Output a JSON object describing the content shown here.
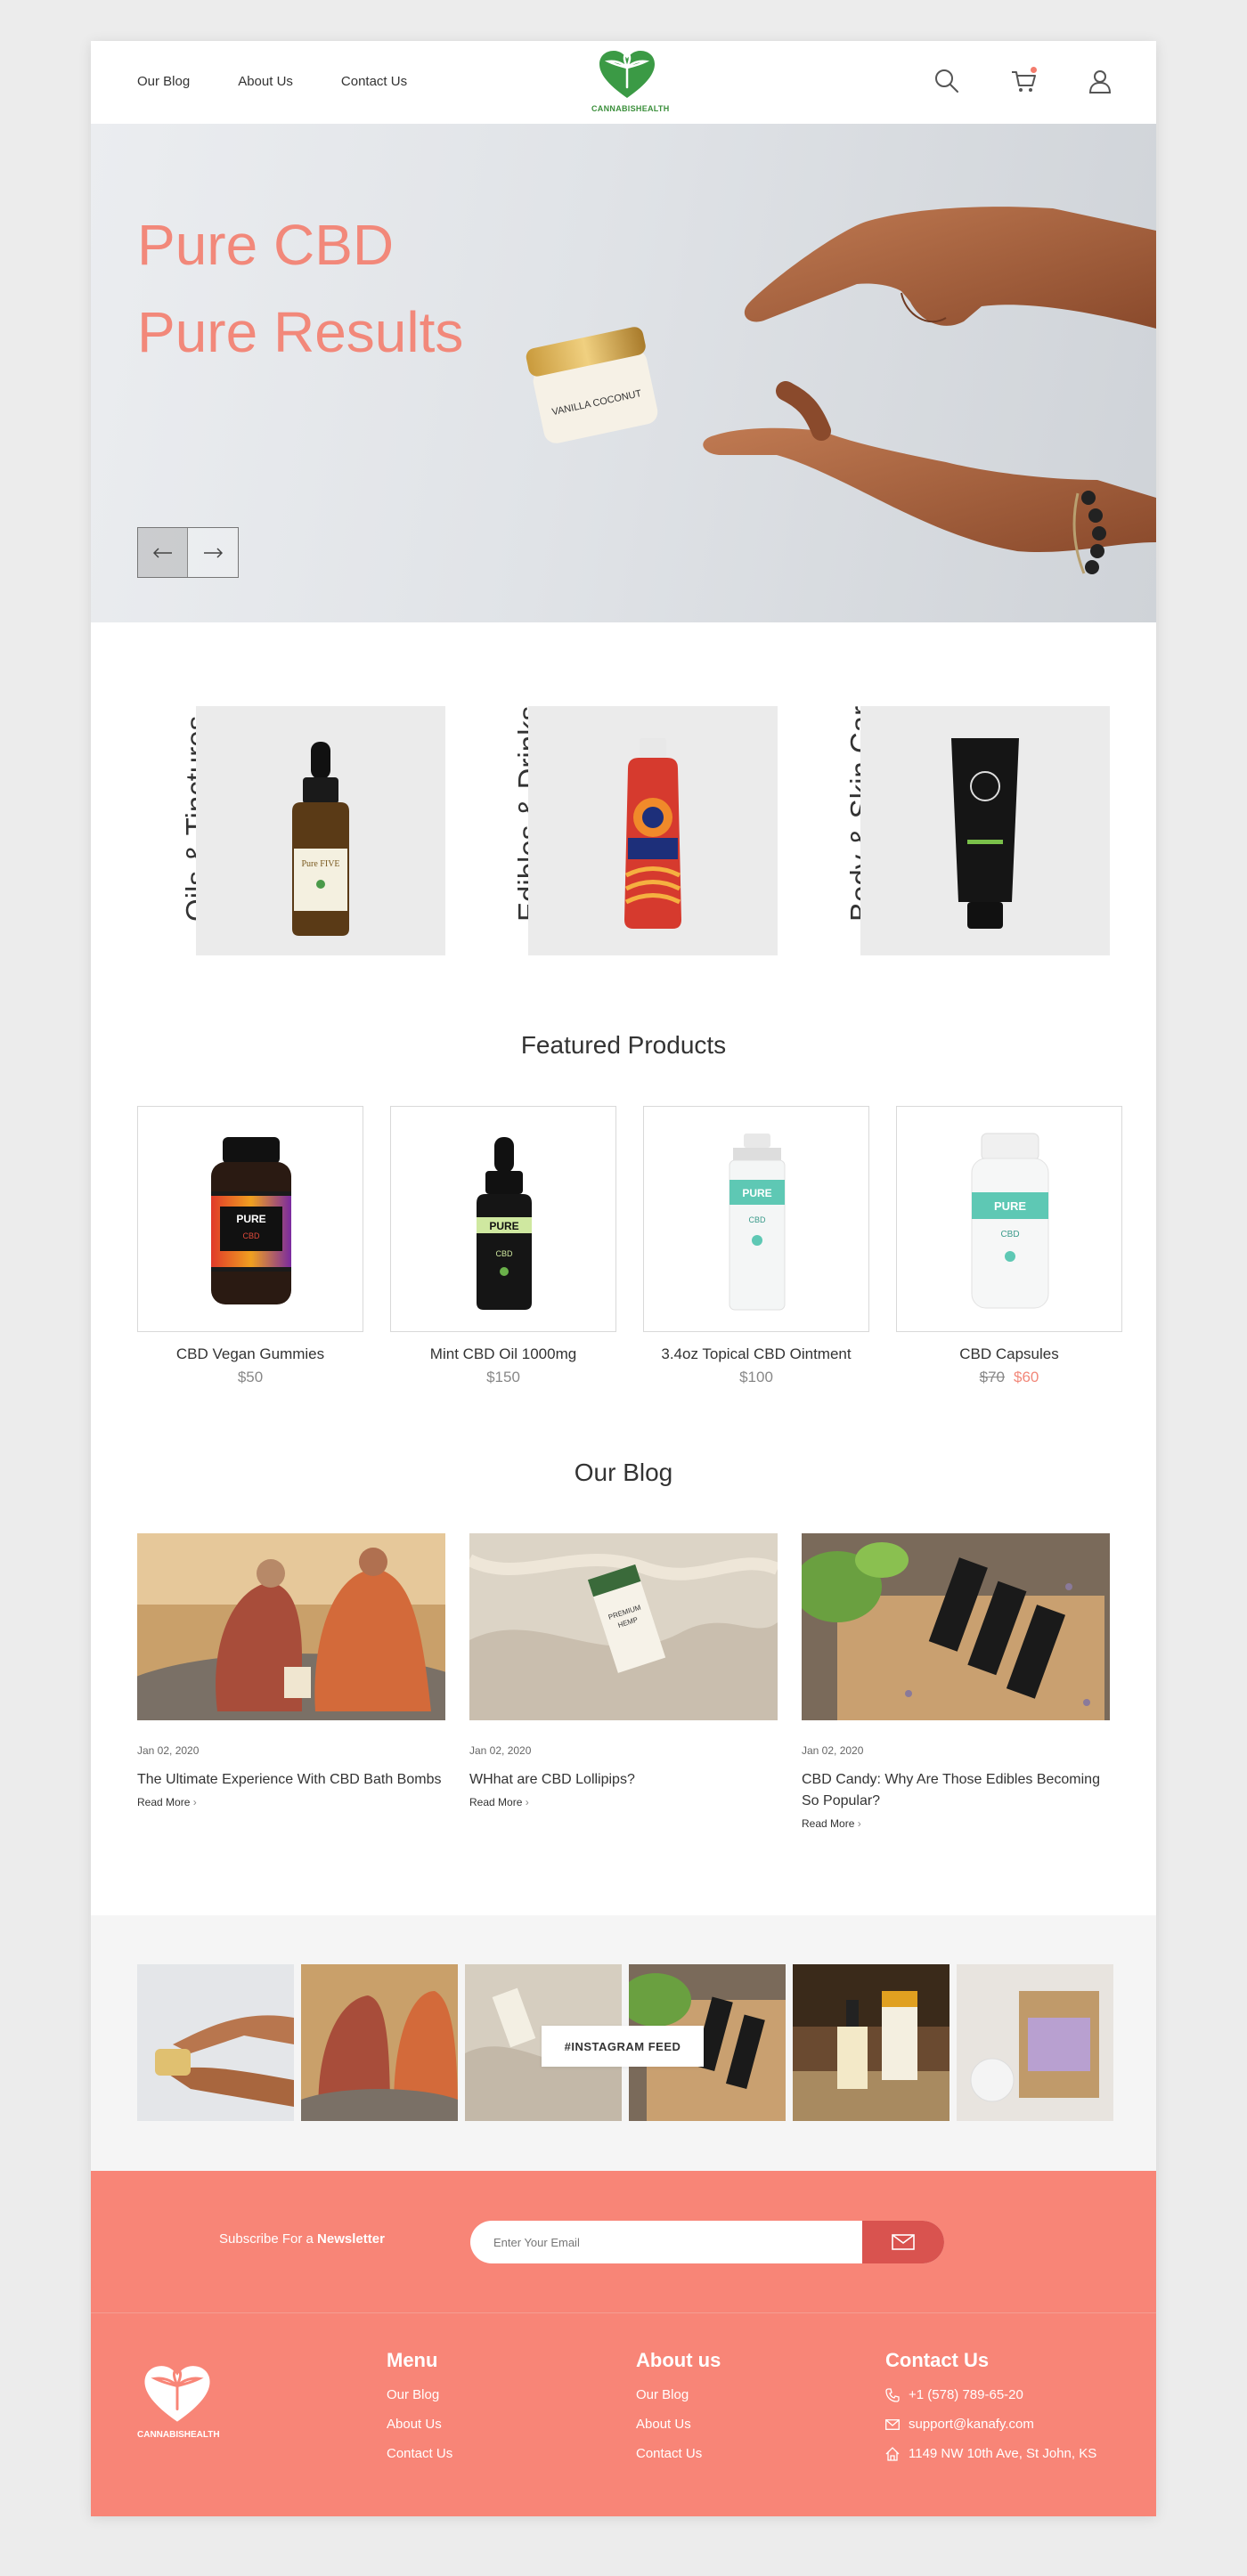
{
  "header": {
    "nav": [
      "Our Blog",
      "About Us",
      "Contact Us"
    ],
    "logo_text": "CANNABISHEALTH",
    "cart_count": ""
  },
  "hero": {
    "title_line1": "Pure CBD",
    "title_line2": "Pure Results",
    "jar_text": "VANILLA COCONUT"
  },
  "categories": [
    "Oils & Tinctures",
    "Edibles & Drinks",
    "Body & Skin Care"
  ],
  "featured": {
    "title": "Featured Products",
    "products": [
      {
        "name": "CBD Vegan Gummies",
        "price": "$50"
      },
      {
        "name": "Mint CBD Oil 1000mg",
        "price": "$150"
      },
      {
        "name": "3.4oz Topical CBD Ointment",
        "price": "$100"
      },
      {
        "name": "CBD Capsules",
        "old_price": "$70",
        "price": "$60"
      }
    ]
  },
  "blog": {
    "title": "Our Blog",
    "posts": [
      {
        "date": "Jan 02, 2020",
        "title": "The Ultimate Experience With CBD Bath Bombs",
        "more": "Read More"
      },
      {
        "date": "Jan 02, 2020",
        "title": "WHhat are CBD Lollipips?",
        "more": "Read More"
      },
      {
        "date": "Jan 02, 2020",
        "title": "CBD Candy: Why Are Those Edibles Becoming So Popular?",
        "more": "Read More"
      }
    ]
  },
  "instagram": {
    "label": "#INSTAGRAM FEED"
  },
  "newsletter": {
    "text_prefix": "Subscribe For a ",
    "text_bold": "Newsletter",
    "placeholder": "Enter Your Email"
  },
  "footer": {
    "logo_text": "CANNABISHEALTH",
    "menu": {
      "title": "Menu",
      "links": [
        "Our Blog",
        "About Us",
        "Contact Us"
      ]
    },
    "about": {
      "title": "About us",
      "links": [
        "Our Blog",
        "About Us",
        "Contact Us"
      ]
    },
    "contact": {
      "title": "Contact Us",
      "phone": "+1 (578) 789-65-20",
      "email": "support@kanafy.com",
      "address": "1149 NW 10th Ave, St John, KS"
    }
  },
  "colors": {
    "accent": "#f88577",
    "accent_dark": "#d9534f",
    "brand_green": "#3b8f3b"
  }
}
